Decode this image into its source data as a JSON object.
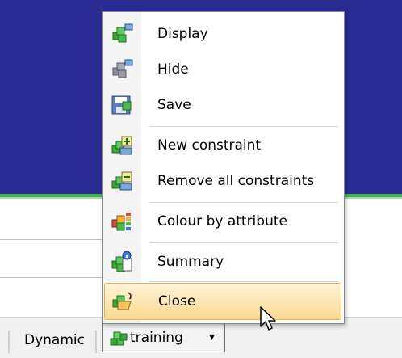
{
  "menu": {
    "items": [
      {
        "label": "Display",
        "icon": "cube-monitor-icon"
      },
      {
        "label": "Hide",
        "icon": "cube-gray-monitor-icon"
      },
      {
        "label": "Save",
        "icon": "floppy-disk-icon"
      },
      {
        "label": "New constraint",
        "icon": "new-constraint-icon"
      },
      {
        "label": "Remove all constraints",
        "icon": "remove-constraints-icon"
      },
      {
        "label": "Colour by attribute",
        "icon": "colour-attribute-icon"
      },
      {
        "label": "Summary",
        "icon": "summary-info-icon"
      },
      {
        "label": "Close",
        "icon": "close-folder-icon"
      }
    ],
    "highlighted": "Close"
  },
  "statusbar": {
    "dynamic_label": "Dynamic",
    "training_label": "training"
  },
  "colors": {
    "background_blue": "#2a2a93",
    "accent_green": "#3ab54a",
    "highlight": "#fbd991"
  }
}
